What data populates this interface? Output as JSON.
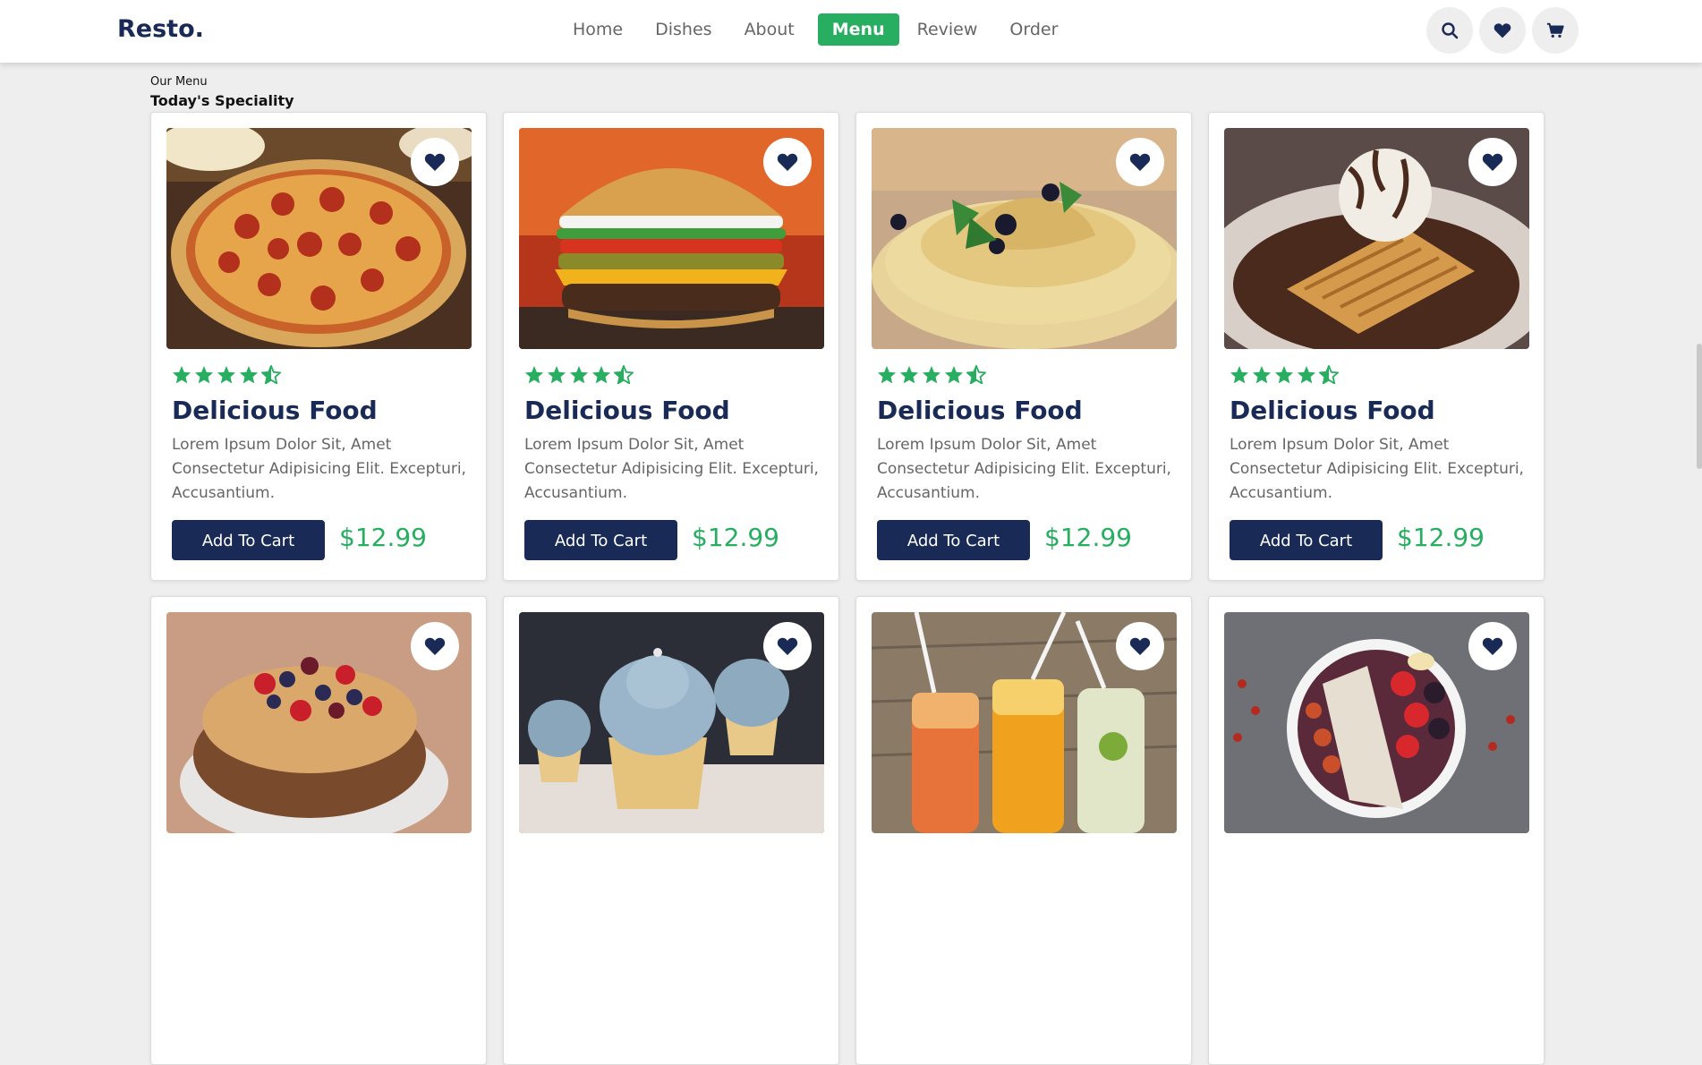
{
  "header": {
    "logo": "Resto.",
    "nav": [
      "Home",
      "Dishes",
      "About",
      "Menu",
      "Review",
      "Order"
    ],
    "active_nav": "Menu"
  },
  "section": {
    "subheading": "Our Menu",
    "heading": "Today's Speciality"
  },
  "colors": {
    "accent": "#27ae60",
    "navy": "#192a56"
  },
  "cards": [
    {
      "image": "pizza",
      "rating": 4.5,
      "title": "Delicious Food",
      "desc": "Lorem Ipsum Dolor Sit, Amet Consectetur Adipisicing Elit. Excepturi, Accusantium.",
      "button": "Add To Cart",
      "price": "$12.99"
    },
    {
      "image": "burger",
      "rating": 4.5,
      "title": "Delicious Food",
      "desc": "Lorem Ipsum Dolor Sit, Amet Consectetur Adipisicing Elit. Excepturi, Accusantium.",
      "button": "Add To Cart",
      "price": "$12.99"
    },
    {
      "image": "crepes",
      "rating": 4.5,
      "title": "Delicious Food",
      "desc": "Lorem Ipsum Dolor Sit, Amet Consectetur Adipisicing Elit. Excepturi, Accusantium.",
      "button": "Add To Cart",
      "price": "$12.99"
    },
    {
      "image": "waffle-ice-cream",
      "rating": 4.5,
      "title": "Delicious Food",
      "desc": "Lorem Ipsum Dolor Sit, Amet Consectetur Adipisicing Elit. Excepturi, Accusantium.",
      "button": "Add To Cart",
      "price": "$12.99"
    },
    {
      "image": "fruit-cake"
    },
    {
      "image": "cupcakes"
    },
    {
      "image": "juices"
    },
    {
      "image": "fruit-bowl"
    }
  ]
}
